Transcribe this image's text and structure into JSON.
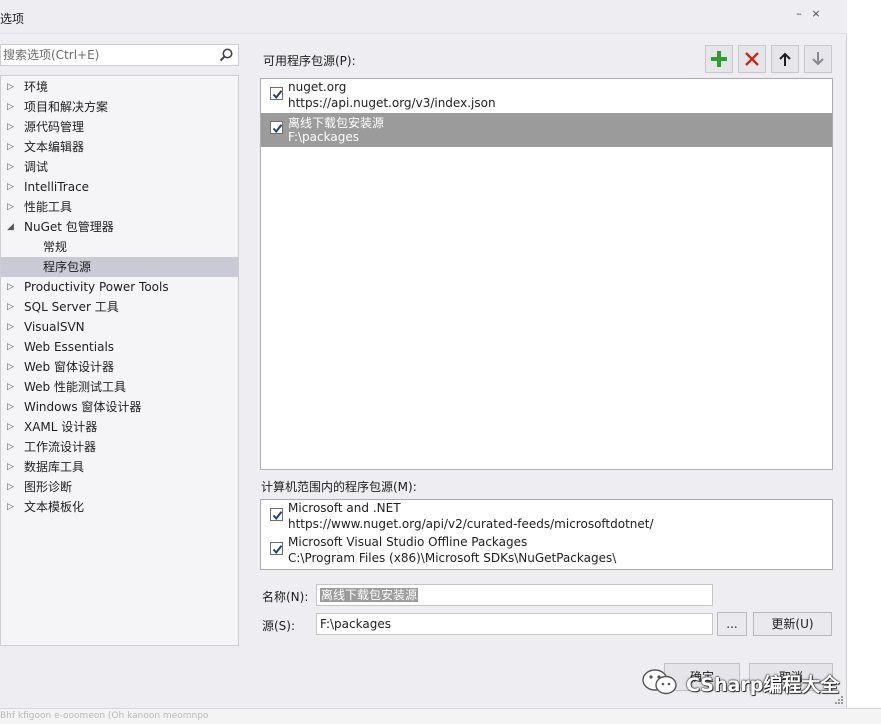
{
  "window": {
    "title": "选项",
    "minimize_glyph": "–",
    "close_glyph": "×"
  },
  "search": {
    "placeholder": "搜索选项(Ctrl+E)"
  },
  "tree": {
    "items": [
      {
        "label": "环境",
        "expanded": false
      },
      {
        "label": "项目和解决方案",
        "expanded": false
      },
      {
        "label": "源代码管理",
        "expanded": false
      },
      {
        "label": "文本编辑器",
        "expanded": false
      },
      {
        "label": "调试",
        "expanded": false
      },
      {
        "label": "IntelliTrace",
        "expanded": false
      },
      {
        "label": "性能工具",
        "expanded": false
      },
      {
        "label": "NuGet 包管理器",
        "expanded": true
      },
      {
        "label": "常规",
        "child": true
      },
      {
        "label": "程序包源",
        "child": true,
        "selected": true
      },
      {
        "label": "Productivity Power Tools",
        "expanded": false
      },
      {
        "label": "SQL Server 工具",
        "expanded": false
      },
      {
        "label": "VisualSVN",
        "expanded": false
      },
      {
        "label": "Web Essentials",
        "expanded": false
      },
      {
        "label": "Web 窗体设计器",
        "expanded": false
      },
      {
        "label": "Web 性能测试工具",
        "expanded": false
      },
      {
        "label": "Windows 窗体设计器",
        "expanded": false
      },
      {
        "label": "XAML 设计器",
        "expanded": false
      },
      {
        "label": "工作流设计器",
        "expanded": false
      },
      {
        "label": "数据库工具",
        "expanded": false
      },
      {
        "label": "图形诊断",
        "expanded": false
      },
      {
        "label": "文本模板化",
        "expanded": false
      }
    ]
  },
  "available_sources": {
    "label": "可用程序包源(P):",
    "items": [
      {
        "name": "nuget.org",
        "url": "https://api.nuget.org/v3/index.json",
        "checked": true,
        "selected": false
      },
      {
        "name": "离线下载包安装源",
        "url": "F:\\packages",
        "checked": true,
        "selected": true
      }
    ]
  },
  "toolbar": {
    "add_icon": "plus-icon",
    "remove_icon": "x-icon",
    "up_icon": "arrow-up-icon",
    "down_icon": "arrow-down-icon",
    "add_color": "#2e9e2e",
    "remove_color": "#c42b1c"
  },
  "machine_sources": {
    "label": "计算机范围内的程序包源(M):",
    "items": [
      {
        "name": "Microsoft and .NET",
        "url": "https://www.nuget.org/api/v2/curated-feeds/microsoftdotnet/",
        "checked": true
      },
      {
        "name": "Microsoft Visual Studio Offline Packages",
        "url": "C:\\Program Files (x86)\\Microsoft SDKs\\NuGetPackages\\",
        "checked": true
      }
    ]
  },
  "form": {
    "name_label": "名称(N):",
    "name_value": "离线下载包安装源",
    "source_label": "源(S):",
    "source_value": "F:\\packages",
    "browse_label": "...",
    "update_label": "更新(U)"
  },
  "footer": {
    "ok_label": "确定",
    "cancel_label": "取消"
  },
  "watermark": {
    "text": "CSharp编程大全"
  },
  "bottom_hint": {
    "text": "Bhf kfigoon e-ooomeon (Oh kanoon meomnpo"
  }
}
